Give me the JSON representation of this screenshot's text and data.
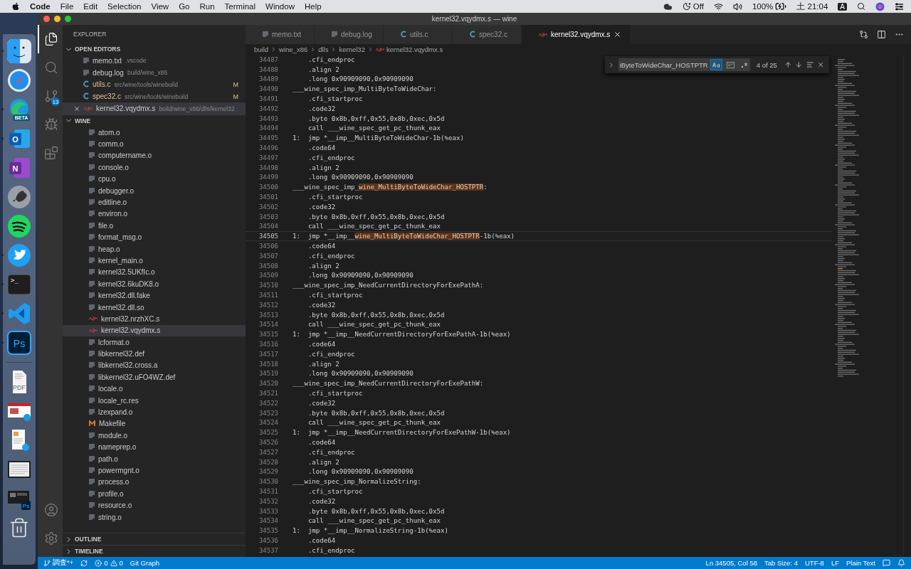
{
  "menu_bar": {
    "app": "Code",
    "items": [
      "File",
      "Edit",
      "Selection",
      "View",
      "Go",
      "Run",
      "Terminal",
      "Window",
      "Help"
    ],
    "focus": "Off",
    "battery": "100%",
    "clock": "土 21:04",
    "input": "A"
  },
  "dock": [
    {
      "kind": "finder",
      "running": true
    },
    {
      "kind": "safari",
      "running": false
    },
    {
      "kind": "edge",
      "glyph": "BETA",
      "running": true
    },
    {
      "kind": "outlook",
      "glyph": "O",
      "running": true
    },
    {
      "kind": "onenote",
      "glyph": "N",
      "running": false
    },
    {
      "kind": "launchpad",
      "running": false
    },
    {
      "kind": "spotify",
      "running": false
    },
    {
      "kind": "twitter",
      "running": true
    },
    {
      "kind": "terminal",
      "glyph": ">_",
      "running": true
    },
    {
      "kind": "vscode",
      "running": true
    },
    {
      "kind": "photoshop",
      "glyph": "Ps",
      "running": true
    },
    {
      "kind": "document",
      "glyph": "PDF"
    },
    {
      "kind": "window-edge"
    },
    {
      "kind": "window-twitter"
    },
    {
      "kind": "window-text"
    },
    {
      "kind": "window-ps",
      "glyph": "Ps"
    },
    {
      "kind": "trash"
    }
  ],
  "window": {
    "title": "kernel32.vqydmx.s — wine"
  },
  "activity_bar": {
    "items": [
      {
        "kind": "explorer",
        "selected": true
      },
      {
        "kind": "search",
        "selected": false
      },
      {
        "kind": "source-control",
        "selected": false,
        "badge": "13"
      },
      {
        "kind": "run",
        "selected": false
      },
      {
        "kind": "extensions",
        "selected": false
      }
    ],
    "bottom": [
      {
        "kind": "account"
      },
      {
        "kind": "settings"
      }
    ]
  },
  "sidebar": {
    "title": "EXPLORER",
    "open_editors": {
      "title": "OPEN EDITORS",
      "expanded": true,
      "items": [
        {
          "name": "memo.txt",
          "path": ".vscode",
          "kind": "text",
          "selected": false
        },
        {
          "name": "debug.log",
          "path": "build/wine_x86",
          "kind": "text",
          "selected": false
        },
        {
          "name": "utils.c",
          "path": "src/wine/tools/winebuild",
          "kind": "c",
          "git_status": "M",
          "selected": false
        },
        {
          "name": "spec32.c",
          "path": "src/wine/tools/winebuild",
          "kind": "c",
          "git_status": "M",
          "selected": false
        },
        {
          "name": "kernel32.vqydmx.s",
          "path": "build/wine_x86/dlls/kernel32",
          "kind": "asm",
          "selected": true
        }
      ]
    },
    "folder": {
      "title": "WINE",
      "expanded": true,
      "items": [
        {
          "name": "atom.o",
          "kind": "file",
          "selected": false
        },
        {
          "name": "comm.o",
          "kind": "file",
          "selected": false
        },
        {
          "name": "computername.o",
          "kind": "file",
          "selected": false
        },
        {
          "name": "console.o",
          "kind": "file",
          "selected": false
        },
        {
          "name": "cpu.o",
          "kind": "file",
          "selected": false
        },
        {
          "name": "debugger.o",
          "kind": "file",
          "selected": false
        },
        {
          "name": "editline.o",
          "kind": "file",
          "selected": false
        },
        {
          "name": "environ.o",
          "kind": "file",
          "selected": false
        },
        {
          "name": "file.o",
          "kind": "file",
          "selected": false
        },
        {
          "name": "format_msg.o",
          "kind": "file",
          "selected": false
        },
        {
          "name": "heap.o",
          "kind": "file",
          "selected": false
        },
        {
          "name": "kernel_main.o",
          "kind": "file",
          "selected": false
        },
        {
          "name": "kernel32.5UKfIc.o",
          "kind": "file",
          "selected": false
        },
        {
          "name": "kernel32.6kuDK8.o",
          "kind": "file",
          "selected": false
        },
        {
          "name": "kernel32.dll.fake",
          "kind": "file",
          "selected": false
        },
        {
          "name": "kernel32.dll.so",
          "kind": "file",
          "selected": false
        },
        {
          "name": "kernel32.nrzhXC.s",
          "kind": "asm",
          "selected": false
        },
        {
          "name": "kernel32.vqydmx.s",
          "kind": "asm",
          "selected": true
        },
        {
          "name": "lcformat.o",
          "kind": "file",
          "selected": false
        },
        {
          "name": "libkernel32.def",
          "kind": "file",
          "selected": false
        },
        {
          "name": "libkernel32.cross.a",
          "kind": "file",
          "selected": false
        },
        {
          "name": "libkernel32.uFO4WZ.def",
          "kind": "file",
          "selected": false
        },
        {
          "name": "locale.o",
          "kind": "file",
          "selected": false
        },
        {
          "name": "locale_rc.res",
          "kind": "file",
          "selected": false
        },
        {
          "name": "lzexpand.o",
          "kind": "file",
          "selected": false
        },
        {
          "name": "Makefile",
          "kind": "makefile",
          "selected": false
        },
        {
          "name": "module.o",
          "kind": "file",
          "selected": false
        },
        {
          "name": "nameprep.o",
          "kind": "file",
          "selected": false
        },
        {
          "name": "path.o",
          "kind": "file",
          "selected": false
        },
        {
          "name": "powermgnt.o",
          "kind": "file",
          "selected": false
        },
        {
          "name": "process.o",
          "kind": "file",
          "selected": false
        },
        {
          "name": "profile.o",
          "kind": "file",
          "selected": false
        },
        {
          "name": "resource.o",
          "kind": "file",
          "selected": false
        },
        {
          "name": "string.o",
          "kind": "file",
          "selected": false
        }
      ]
    },
    "outline": {
      "title": "OUTLINE",
      "expanded": false
    },
    "timeline": {
      "title": "TIMELINE",
      "expanded": false
    }
  },
  "tabs": [
    {
      "label": "memo.txt",
      "kind": "text",
      "selected": false
    },
    {
      "label": "debug.log",
      "kind": "text",
      "selected": false
    },
    {
      "label": "utils.c",
      "kind": "c",
      "selected": false
    },
    {
      "label": "spec32.c",
      "kind": "c",
      "selected": false
    },
    {
      "label": "kernel32.vqydmx.s",
      "kind": "asm",
      "selected": true
    }
  ],
  "breadcrumb": [
    "build",
    "wine_x86",
    "dlls",
    "kernel32",
    "kernel32.vqydmx.s"
  ],
  "find": {
    "replace_expanded": false,
    "value": "iByteToWideChar_HOSTPTR",
    "match_case": true,
    "whole_word": false,
    "regex": false,
    "count": "4 of 25"
  },
  "lines": [
    {
      "number": "34487",
      "segments": [
        {
          "text": "    .cfi_endproc",
          "match": false
        }
      ],
      "current": false
    },
    {
      "number": "34488",
      "segments": [
        {
          "text": "    .align 2",
          "match": false
        }
      ],
      "current": false
    },
    {
      "number": "34489",
      "segments": [
        {
          "text": "    .long 0x90909090,0x90909090",
          "match": false
        }
      ],
      "current": false
    },
    {
      "number": "34490",
      "segments": [
        {
          "text": "___wine_spec_imp_MultiByteToWideChar:",
          "match": false
        }
      ],
      "current": false
    },
    {
      "number": "34491",
      "segments": [
        {
          "text": "    .cfi_startproc",
          "match": false
        }
      ],
      "current": false
    },
    {
      "number": "34492",
      "segments": [
        {
          "text": "    .code32",
          "match": false
        }
      ],
      "current": false
    },
    {
      "number": "34493",
      "segments": [
        {
          "text": "    .byte 0x8b,0xff,0x55,0x8b,0xec,0x5d",
          "match": false
        }
      ],
      "current": false
    },
    {
      "number": "34494",
      "segments": [
        {
          "text": "    call ___wine_spec_get_pc_thunk_eax",
          "match": false
        }
      ],
      "current": false
    },
    {
      "number": "34495",
      "segments": [
        {
          "text": "1:  jmp *__imp__MultiByteToWideChar-1b(%eax)",
          "match": false
        }
      ],
      "current": false
    },
    {
      "number": "34496",
      "segments": [
        {
          "text": "    .code64",
          "match": false
        }
      ],
      "current": false
    },
    {
      "number": "34497",
      "segments": [
        {
          "text": "    .cfi_endproc",
          "match": false
        }
      ],
      "current": false
    },
    {
      "number": "34498",
      "segments": [
        {
          "text": "    .align 2",
          "match": false
        }
      ],
      "current": false
    },
    {
      "number": "34499",
      "segments": [
        {
          "text": "    .long 0x90909090,0x90909090",
          "match": false
        }
      ],
      "current": false
    },
    {
      "number": "34500",
      "segments": [
        {
          "text": "___wine_spec_imp_",
          "match": false
        },
        {
          "text": "wine_MultiByteToWideChar_HOSTPTR",
          "match": true
        },
        {
          "text": ":",
          "match": false
        }
      ],
      "current": false
    },
    {
      "number": "34501",
      "segments": [
        {
          "text": "    .cfi_startproc",
          "match": false
        }
      ],
      "current": false
    },
    {
      "number": "34502",
      "segments": [
        {
          "text": "    .code32",
          "match": false
        }
      ],
      "current": false
    },
    {
      "number": "34503",
      "segments": [
        {
          "text": "    .byte 0x8b,0xff,0x55,0x8b,0xec,0x5d",
          "match": false
        }
      ],
      "current": false
    },
    {
      "number": "34504",
      "segments": [
        {
          "text": "    call ___wine_spec_get_pc_thunk_eax",
          "match": false
        }
      ],
      "current": false
    },
    {
      "number": "34505",
      "segments": [
        {
          "text": "1:  jmp *__imp__",
          "match": false
        },
        {
          "text": "wine_MultiByteToWideChar_HOSTPTR",
          "match": true
        },
        {
          "text": "-1b(%eax)",
          "match": false
        }
      ],
      "current": true
    },
    {
      "number": "34506",
      "segments": [
        {
          "text": "    .code64",
          "match": false
        }
      ],
      "current": false
    },
    {
      "number": "34507",
      "segments": [
        {
          "text": "    .cfi_endproc",
          "match": false
        }
      ],
      "current": false
    },
    {
      "number": "34508",
      "segments": [
        {
          "text": "    .align 2",
          "match": false
        }
      ],
      "current": false
    },
    {
      "number": "34509",
      "segments": [
        {
          "text": "    .long 0x90909090,0x90909090",
          "match": false
        }
      ],
      "current": false
    },
    {
      "number": "34510",
      "segments": [
        {
          "text": "___wine_spec_imp_NeedCurrentDirectoryForExePathA:",
          "match": false
        }
      ],
      "current": false
    },
    {
      "number": "34511",
      "segments": [
        {
          "text": "    .cfi_startproc",
          "match": false
        }
      ],
      "current": false
    },
    {
      "number": "34512",
      "segments": [
        {
          "text": "    .code32",
          "match": false
        }
      ],
      "current": false
    },
    {
      "number": "34513",
      "segments": [
        {
          "text": "    .byte 0x8b,0xff,0x55,0x8b,0xec,0x5d",
          "match": false
        }
      ],
      "current": false
    },
    {
      "number": "34514",
      "segments": [
        {
          "text": "    call ___wine_spec_get_pc_thunk_eax",
          "match": false
        }
      ],
      "current": false
    },
    {
      "number": "34515",
      "segments": [
        {
          "text": "1:  jmp *__imp__NeedCurrentDirectoryForExePathA-1b(%eax)",
          "match": false
        }
      ],
      "current": false
    },
    {
      "number": "34516",
      "segments": [
        {
          "text": "    .code64",
          "match": false
        }
      ],
      "current": false
    },
    {
      "number": "34517",
      "segments": [
        {
          "text": "    .cfi_endproc",
          "match": false
        }
      ],
      "current": false
    },
    {
      "number": "34518",
      "segments": [
        {
          "text": "    .align 2",
          "match": false
        }
      ],
      "current": false
    },
    {
      "number": "34519",
      "segments": [
        {
          "text": "    .long 0x90909090,0x90909090",
          "match": false
        }
      ],
      "current": false
    },
    {
      "number": "34520",
      "segments": [
        {
          "text": "___wine_spec_imp_NeedCurrentDirectoryForExePathW:",
          "match": false
        }
      ],
      "current": false
    },
    {
      "number": "34521",
      "segments": [
        {
          "text": "    .cfi_startproc",
          "match": false
        }
      ],
      "current": false
    },
    {
      "number": "34522",
      "segments": [
        {
          "text": "    .code32",
          "match": false
        }
      ],
      "current": false
    },
    {
      "number": "34523",
      "segments": [
        {
          "text": "    .byte 0x8b,0xff,0x55,0x8b,0xec,0x5d",
          "match": false
        }
      ],
      "current": false
    },
    {
      "number": "34524",
      "segments": [
        {
          "text": "    call ___wine_spec_get_pc_thunk_eax",
          "match": false
        }
      ],
      "current": false
    },
    {
      "number": "34525",
      "segments": [
        {
          "text": "1:  jmp *__imp__NeedCurrentDirectoryForExePathW-1b(%eax)",
          "match": false
        }
      ],
      "current": false
    },
    {
      "number": "34526",
      "segments": [
        {
          "text": "    .code64",
          "match": false
        }
      ],
      "current": false
    },
    {
      "number": "34527",
      "segments": [
        {
          "text": "    .cfi_endproc",
          "match": false
        }
      ],
      "current": false
    },
    {
      "number": "34528",
      "segments": [
        {
          "text": "    .align 2",
          "match": false
        }
      ],
      "current": false
    },
    {
      "number": "34529",
      "segments": [
        {
          "text": "    .long 0x90909090,0x90909090",
          "match": false
        }
      ],
      "current": false
    },
    {
      "number": "34530",
      "segments": [
        {
          "text": "___wine_spec_imp_NormalizeString:",
          "match": false
        }
      ],
      "current": false
    },
    {
      "number": "34531",
      "segments": [
        {
          "text": "    .cfi_startproc",
          "match": false
        }
      ],
      "current": false
    },
    {
      "number": "34532",
      "segments": [
        {
          "text": "    .code32",
          "match": false
        }
      ],
      "current": false
    },
    {
      "number": "34533",
      "segments": [
        {
          "text": "    .byte 0x8b,0xff,0x55,0x8b,0xec,0x5d",
          "match": false
        }
      ],
      "current": false
    },
    {
      "number": "34534",
      "segments": [
        {
          "text": "    call ___wine_spec_get_pc_thunk_eax",
          "match": false
        }
      ],
      "current": false
    },
    {
      "number": "34535",
      "segments": [
        {
          "text": "1:  jmp *__imp__NormalizeString-1b(%eax)",
          "match": false
        }
      ],
      "current": false
    },
    {
      "number": "34536",
      "segments": [
        {
          "text": "    .code64",
          "match": false
        }
      ],
      "current": false
    },
    {
      "number": "34537",
      "segments": [
        {
          "text": "    .cfi_endproc",
          "match": false
        }
      ],
      "current": false
    }
  ],
  "status_bar": {
    "branch": "調査*+",
    "errors": "0",
    "warnings": "0",
    "git_graph": "Git Graph",
    "position": "Ln 34505, Col 58",
    "tab_size": "Tab Size: 4",
    "encoding": "UTF-8",
    "eol": "LF",
    "language": "Plain Text"
  }
}
